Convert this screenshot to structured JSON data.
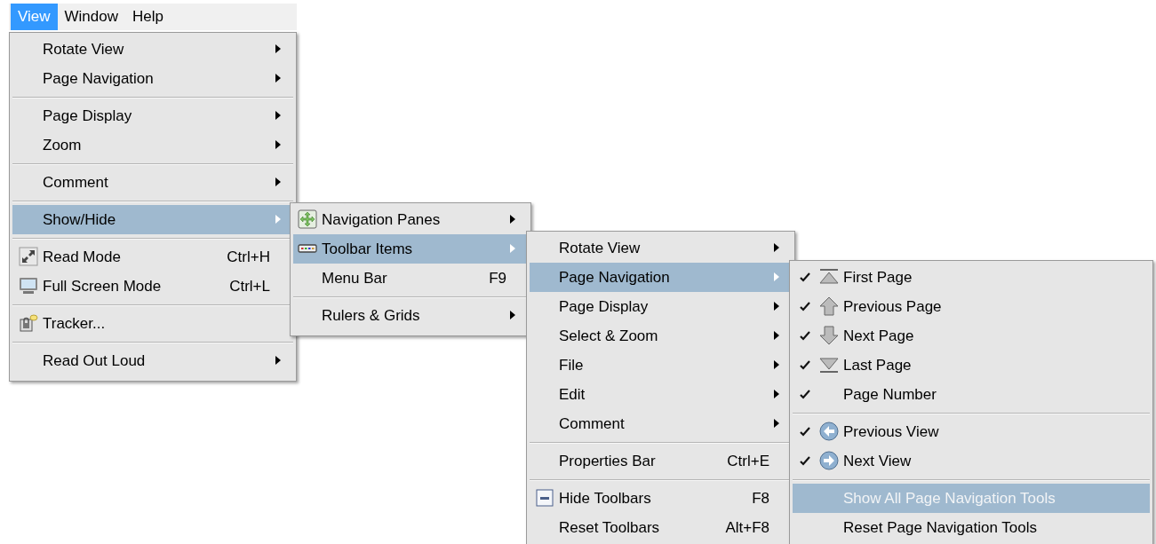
{
  "menu_bar": [
    {
      "label": "View",
      "selected": true
    },
    {
      "label": "Window",
      "selected": false
    },
    {
      "label": "Help",
      "selected": false
    }
  ],
  "menus": [
    {
      "items": [
        {
          "kind": "item",
          "label": "Rotate View",
          "submenu": true,
          "selected": false
        },
        {
          "kind": "item",
          "label": "Page Navigation",
          "submenu": true,
          "selected": false
        },
        {
          "kind": "separator"
        },
        {
          "kind": "item",
          "label": "Page Display",
          "submenu": true,
          "selected": false
        },
        {
          "kind": "item",
          "label": "Zoom",
          "submenu": true,
          "selected": false
        },
        {
          "kind": "separator"
        },
        {
          "kind": "item",
          "label": "Comment",
          "submenu": true,
          "selected": false
        },
        {
          "kind": "separator"
        },
        {
          "kind": "item",
          "label": "Show/Hide",
          "submenu": true,
          "selected": true
        },
        {
          "kind": "separator"
        },
        {
          "kind": "item",
          "label": "Read Mode",
          "shortcut": "Ctrl+H",
          "submenu": false,
          "selected": false
        },
        {
          "kind": "item",
          "label": "Full Screen Mode",
          "shortcut": "Ctrl+L",
          "submenu": false,
          "selected": false
        },
        {
          "kind": "separator"
        },
        {
          "kind": "item",
          "label": "Tracker...",
          "submenu": false,
          "selected": false
        },
        {
          "kind": "separator"
        },
        {
          "kind": "item",
          "label": "Read Out Loud",
          "submenu": true,
          "selected": false
        }
      ]
    },
    {
      "items": [
        {
          "kind": "item",
          "label": "Navigation Panes",
          "submenu": true,
          "selected": false
        },
        {
          "kind": "item",
          "label": "Toolbar Items",
          "submenu": true,
          "selected": true
        },
        {
          "kind": "item",
          "label": "Menu Bar",
          "shortcut": "F9",
          "submenu": false,
          "selected": false
        },
        {
          "kind": "separator"
        },
        {
          "kind": "item",
          "label": "Rulers & Grids",
          "submenu": true,
          "selected": false
        }
      ]
    },
    {
      "items": [
        {
          "kind": "item",
          "label": "Rotate View",
          "submenu": true,
          "selected": false
        },
        {
          "kind": "item",
          "label": "Page Navigation",
          "submenu": true,
          "selected": true
        },
        {
          "kind": "item",
          "label": "Page Display",
          "submenu": true,
          "selected": false
        },
        {
          "kind": "item",
          "label": "Select & Zoom",
          "submenu": true,
          "selected": false
        },
        {
          "kind": "item",
          "label": "File",
          "submenu": true,
          "selected": false
        },
        {
          "kind": "item",
          "label": "Edit",
          "submenu": true,
          "selected": false
        },
        {
          "kind": "item",
          "label": "Comment",
          "submenu": true,
          "selected": false
        },
        {
          "kind": "separator"
        },
        {
          "kind": "item",
          "label": "Properties Bar",
          "shortcut": "Ctrl+E",
          "submenu": false,
          "selected": false
        },
        {
          "kind": "separator"
        },
        {
          "kind": "item",
          "label": "Hide Toolbars",
          "shortcut": "F8",
          "submenu": false,
          "selected": false
        },
        {
          "kind": "item",
          "label": "Reset Toolbars",
          "shortcut": "Alt+F8",
          "submenu": false,
          "selected": false
        }
      ]
    },
    {
      "items": [
        {
          "kind": "item",
          "label": "First Page",
          "checked": true,
          "disabled": false,
          "submenu": false,
          "selected": false
        },
        {
          "kind": "item",
          "label": "Previous Page",
          "checked": true,
          "disabled": false,
          "submenu": false,
          "selected": false
        },
        {
          "kind": "item",
          "label": "Next Page",
          "checked": true,
          "disabled": false,
          "submenu": false,
          "selected": false
        },
        {
          "kind": "item",
          "label": "Last Page",
          "checked": true,
          "disabled": false,
          "submenu": false,
          "selected": false
        },
        {
          "kind": "item",
          "label": "Page Number",
          "checked": true,
          "disabled": false,
          "submenu": false,
          "selected": false
        },
        {
          "kind": "separator"
        },
        {
          "kind": "item",
          "label": "Previous View",
          "checked": true,
          "disabled": false,
          "submenu": false,
          "selected": false
        },
        {
          "kind": "item",
          "label": "Next View",
          "checked": true,
          "disabled": false,
          "submenu": false,
          "selected": false
        },
        {
          "kind": "separator"
        },
        {
          "kind": "item",
          "label": "Show All Page Navigation Tools",
          "checked": false,
          "disabled": true,
          "submenu": false,
          "selected": true
        },
        {
          "kind": "item",
          "label": "Reset Page Navigation Tools",
          "checked": false,
          "disabled": false,
          "submenu": false,
          "selected": false
        }
      ]
    }
  ]
}
